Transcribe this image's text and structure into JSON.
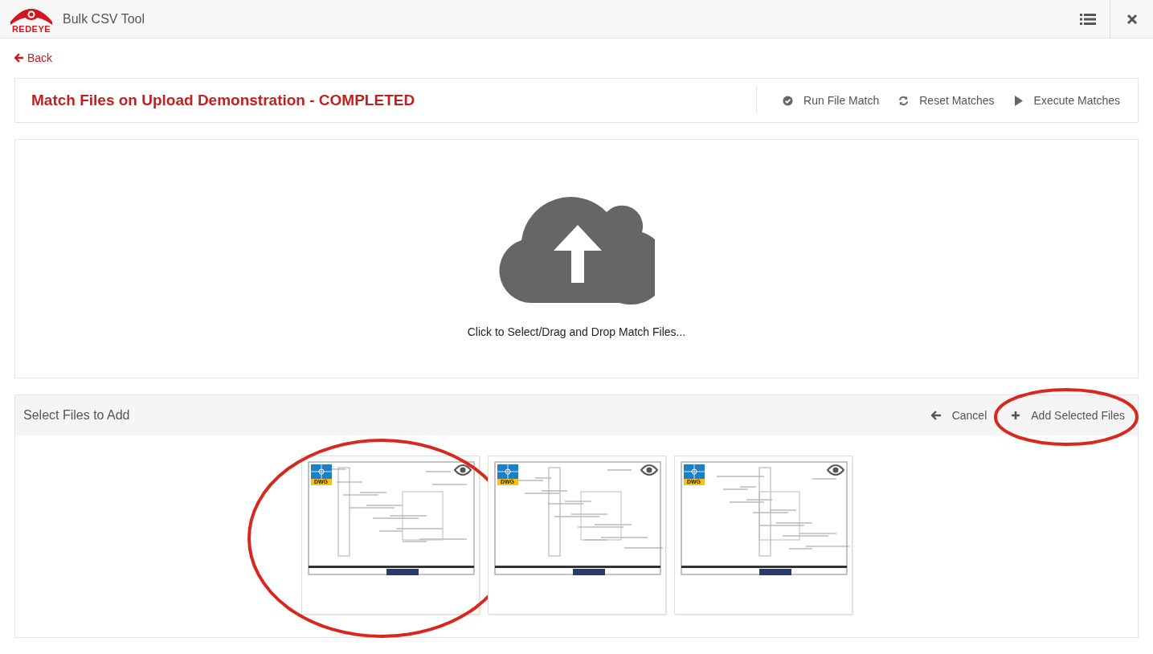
{
  "header": {
    "logo_text": "REDEYE",
    "title": "Bulk CSV Tool"
  },
  "back": {
    "label": "Back"
  },
  "job": {
    "title": "Match Files on Upload Demonstration - COMPLETED",
    "actions": [
      {
        "kind": "check",
        "label": "Run File Match"
      },
      {
        "kind": "refresh",
        "label": "Reset Matches"
      },
      {
        "kind": "play",
        "label": "Execute Matches"
      }
    ]
  },
  "upload": {
    "prompt": "Click to Select/Drag and Drop Match Files..."
  },
  "select": {
    "title": "Select Files to Add",
    "cancel": {
      "label": "Cancel"
    },
    "add": {
      "label": "Add Selected Files",
      "circled": true
    },
    "files": [
      {
        "type": "DWG",
        "circled": true
      },
      {
        "type": "DWG",
        "circled": false
      },
      {
        "type": "DWG",
        "circled": false
      }
    ]
  }
}
